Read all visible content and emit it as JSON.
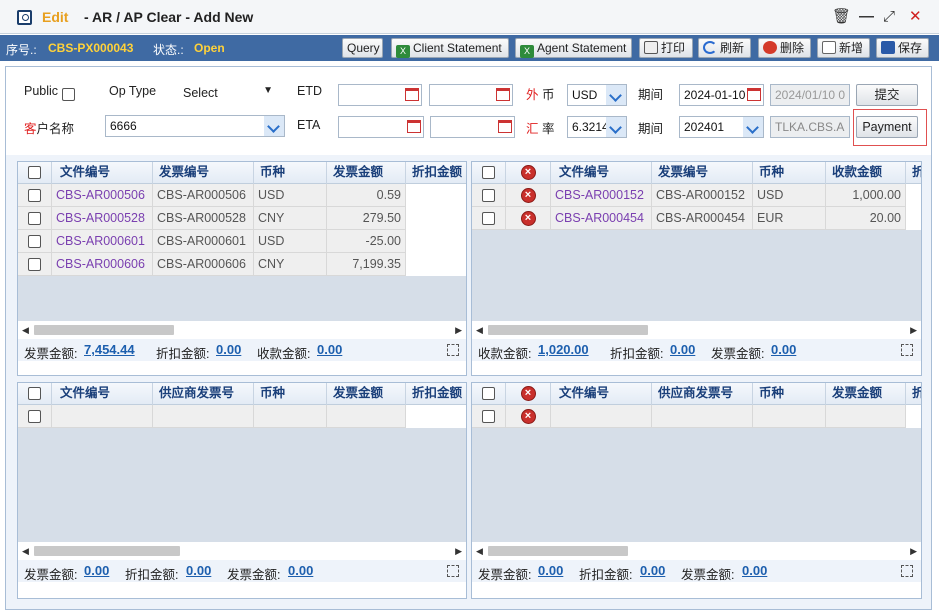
{
  "window": {
    "mode": "Edit",
    "title": "- AR / AP Clear - Add New"
  },
  "info": {
    "seq_label": "序号.:",
    "seq_value": "CBS-PX000043",
    "status_label": "状态.:",
    "status_value": "Open"
  },
  "toolbar": {
    "query": "Query",
    "client_statement": "Client Statement",
    "agent_statement": "Agent Statement",
    "print": "打印",
    "refresh": "刷新",
    "delete": "删除",
    "add": "新增",
    "save": "保存"
  },
  "form": {
    "public_label": "Public",
    "op_type_label": "Op Type",
    "op_type_value": "Select",
    "etd_label": "ETD",
    "currency_label_a": "外",
    "currency_label_b": "币",
    "currency_value": "USD",
    "period_label": "期间",
    "period_date": "2024-01-10",
    "period_date_gray": "2024/01/10 0",
    "submit": "提交",
    "customer_label_a": "客",
    "customer_label_b": "户名称",
    "customer_value": "6666",
    "eta_label": "ETA",
    "rate_label_a": "汇",
    "rate_label_b": "率",
    "rate_value": "6.3214",
    "period2_label": "期间",
    "period2_value": "202401",
    "user_value": "TLKA.CBS.A",
    "payment": "Payment"
  },
  "grid_ar": {
    "columns": [
      "文件编号",
      "发票编号",
      "币种",
      "发票金额",
      "折扣金额"
    ],
    "rows": [
      {
        "file": "CBS-AR000506",
        "invoice": "CBS-AR000506",
        "currency": "USD",
        "amount": "0.59",
        "discount": ""
      },
      {
        "file": "CBS-AR000528",
        "invoice": "CBS-AR000528",
        "currency": "CNY",
        "amount": "279.50",
        "discount": ""
      },
      {
        "file": "CBS-AR000601",
        "invoice": "CBS-AR000601",
        "currency": "USD",
        "amount": "-25.00",
        "discount": ""
      },
      {
        "file": "CBS-AR000606",
        "invoice": "CBS-AR000606",
        "currency": "CNY",
        "amount": "7,199.35",
        "discount": ""
      }
    ],
    "footer": {
      "l1": "发票金额:",
      "v1": "7,454.44",
      "l2": "折扣金额:",
      "v2": "0.00",
      "l3": "收款金额:",
      "v3": "0.00"
    }
  },
  "grid_ar_selected": {
    "columns": [
      "文件编号",
      "发票编号",
      "币种",
      "收款金额",
      "折"
    ],
    "rows": [
      {
        "file": "CBS-AR000152",
        "invoice": "CBS-AR000152",
        "currency": "USD",
        "amount": "1,000.00"
      },
      {
        "file": "CBS-AR000454",
        "invoice": "CBS-AR000454",
        "currency": "EUR",
        "amount": "20.00"
      }
    ],
    "footer": {
      "l1": "收款金额:",
      "v1": "1,020.00",
      "l2": "折扣金额:",
      "v2": "0.00",
      "l3": "发票金额:",
      "v3": "0.00"
    }
  },
  "grid_ap": {
    "columns": [
      "文件编号",
      "供应商发票号",
      "币种",
      "发票金额",
      "折扣金额"
    ],
    "footer": {
      "l1": "发票金额:",
      "v1": "0.00",
      "l2": "折扣金额:",
      "v2": "0.00",
      "l3": "发票金额:",
      "v3": "0.00"
    }
  },
  "grid_ap_selected": {
    "columns": [
      "文件编号",
      "供应商发票号",
      "币种",
      "发票金额",
      "折"
    ],
    "footer": {
      "l1": "发票金额:",
      "v1": "0.00",
      "l2": "折扣金额:",
      "v2": "0.00",
      "l3": "发票金额:",
      "v3": "0.00"
    }
  }
}
